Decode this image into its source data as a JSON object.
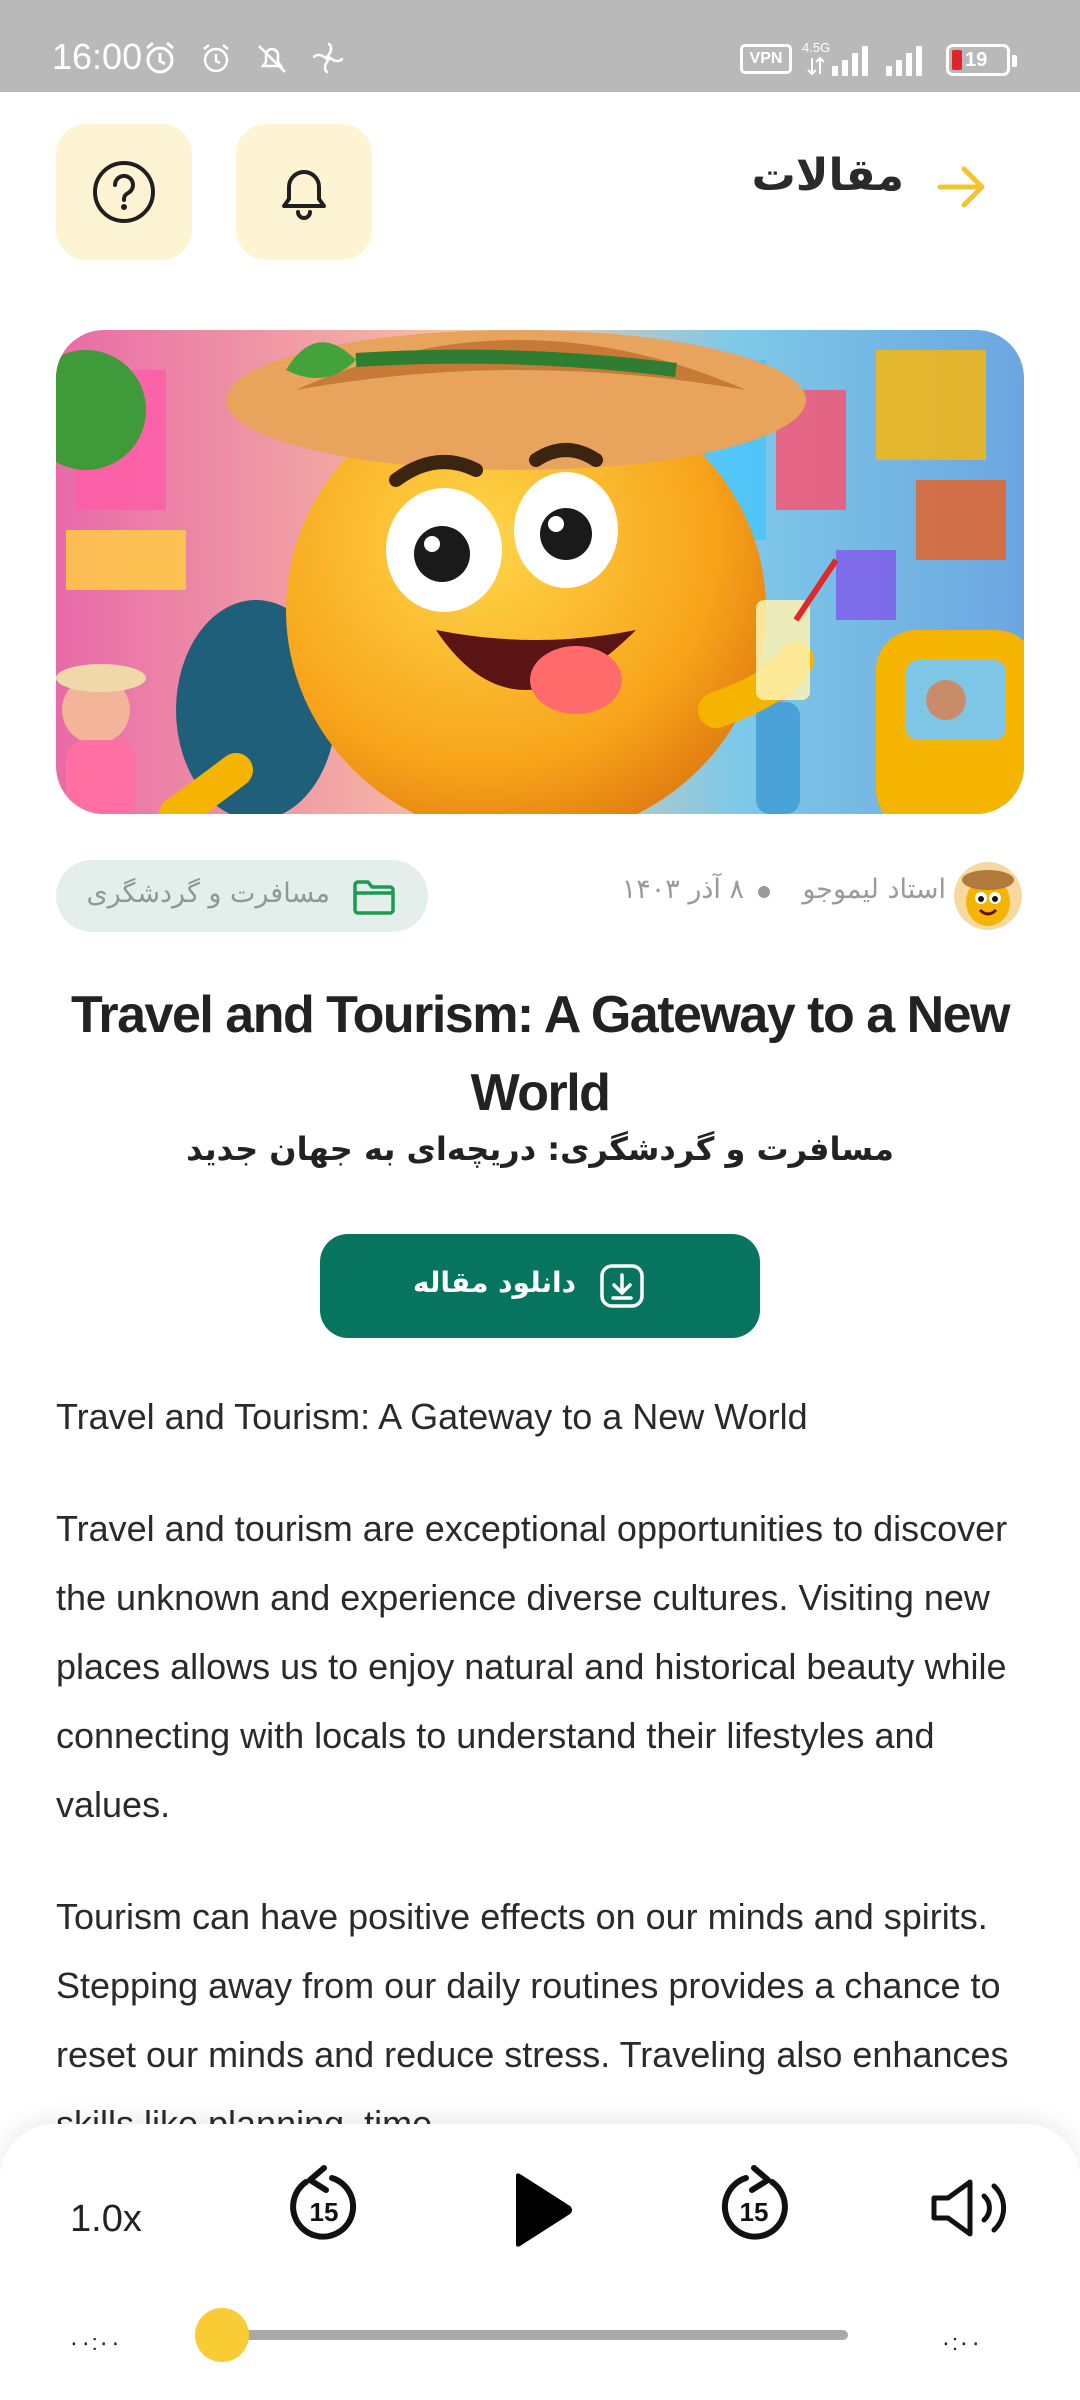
{
  "status_bar": {
    "time": "16:00",
    "vpn": "VPN",
    "network": "4.5G",
    "battery": "19",
    "icons": [
      "alarm-icon",
      "alarm-outline-icon",
      "notifications-off-icon",
      "fan-icon",
      "signal-icon",
      "signal-icon",
      "battery-icon"
    ]
  },
  "header": {
    "title": "مقالات",
    "back_icon": "arrow-right-icon",
    "help_icon": "question-circle-icon",
    "bell_icon": "bell-icon"
  },
  "article": {
    "category": "مسافرت و گردشگری",
    "category_icon": "folder-icon",
    "author": "استاد لیموجو",
    "date": "۸ آذر ۱۴۰۳",
    "title_en": "Travel and Tourism: A Gateway to a New World",
    "title_fa": "مسافرت و گردشگری: دریچه‌ای به جهان جدید",
    "download_label": "دانلود مقاله",
    "download_icon": "download-icon",
    "paragraphs": [
      "Travel and Tourism: A Gateway to a New World",
      "Travel and tourism are exceptional opportunities to discover the unknown and experience diverse cultures. Visiting new places allows us to enjoy natural and historical beauty while connecting with locals to understand their lifestyles and values.",
      "Tourism can have positive effects on our minds and spirits. Stepping away from our daily routines provides a chance to reset our minds and reduce stress. Traveling also enhances skills like planning, time"
    ]
  },
  "player": {
    "speed": "1.0x",
    "current_time": "۰۰:۰۰",
    "total_time": "۰:۰۰",
    "progress": 0,
    "rewind_seconds": "15",
    "forward_seconds": "15"
  },
  "colors": {
    "accent_yellow": "#f9cc36",
    "primary_green": "#06745f",
    "header_button_bg": "#fdf4d3",
    "category_bg": "#e4eeea"
  }
}
